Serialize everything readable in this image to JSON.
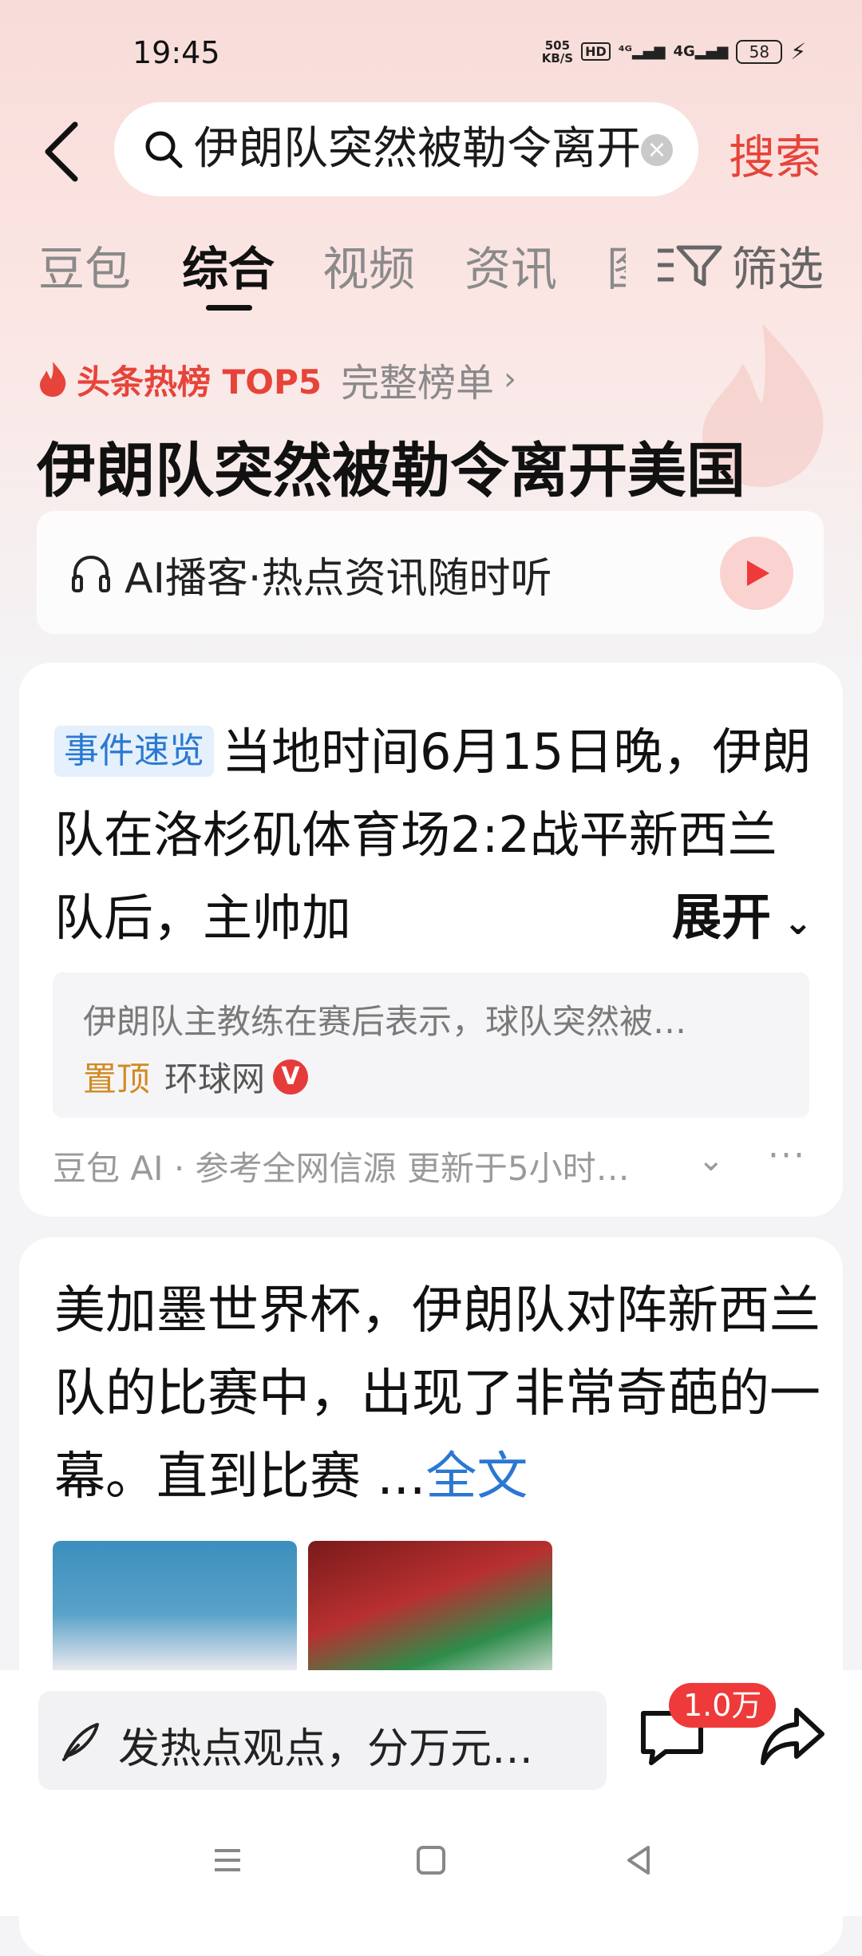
{
  "status_bar": {
    "time": "19:45",
    "net_speed_value": "505",
    "net_speed_unit": "KB/S",
    "hd": "HD",
    "sig1": "⁴ᴳ",
    "sig2": "4G",
    "battery": "58"
  },
  "search": {
    "query": "伊朗队突然被勒令离开美国",
    "button": "搜索"
  },
  "tabs": [
    {
      "label": "豆包"
    },
    {
      "label": "综合"
    },
    {
      "label": "视频"
    },
    {
      "label": "资讯"
    },
    {
      "label": "图"
    }
  ],
  "filter_label": "筛选",
  "hotlist": {
    "label": "头条热榜 TOP5",
    "full": "完整榜单",
    "chevron": "›"
  },
  "headline": "伊朗队突然被勒令离开美国",
  "podcast": {
    "text": "AI播客·热点资讯随时听"
  },
  "card1": {
    "badge": "事件速览",
    "summary": "当地时间6月15日晚，伊朗队在洛杉矶体育场2:2战平新西兰队后，主帅加",
    "expand": "展开",
    "snippet": "伊朗队主教练在赛后表示，球队突然被…",
    "pin": "置顶",
    "site": "环球网",
    "verified": "V",
    "meta": "豆包 AI · 参考全网信源  更新于5小时…"
  },
  "card2": {
    "text": "美加墨世界杯，伊朗队对阵新西兰队的比赛中，出现了非常奇葩的一幕。直到比赛 ...",
    "fulltext": "全文"
  },
  "bottom": {
    "comment_placeholder": "发热点观点，分万元…",
    "comment_count": "1.0万"
  }
}
